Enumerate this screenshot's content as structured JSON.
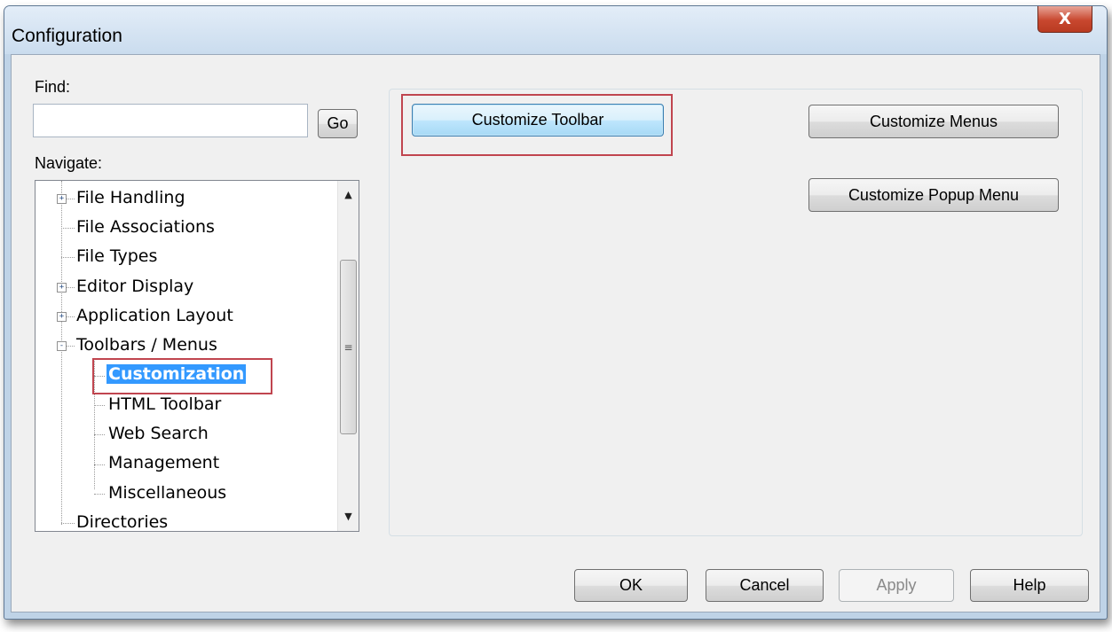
{
  "window": {
    "title": "Configuration",
    "close_glyph": "X"
  },
  "find": {
    "label": "Find:",
    "value": "",
    "go_label": "Go"
  },
  "navigate": {
    "label": "Navigate:",
    "tree": [
      {
        "label": "File Handling",
        "expander": "+",
        "level": 0
      },
      {
        "label": "File Associations",
        "expander": "",
        "level": 0
      },
      {
        "label": "File Types",
        "expander": "",
        "level": 0
      },
      {
        "label": "Editor Display",
        "expander": "+",
        "level": 0
      },
      {
        "label": "Application Layout",
        "expander": "+",
        "level": 0
      },
      {
        "label": "Toolbars / Menus",
        "expander": "-",
        "level": 0
      },
      {
        "label": "Customization",
        "expander": "",
        "level": 1,
        "selected": true
      },
      {
        "label": "HTML Toolbar",
        "expander": "",
        "level": 1
      },
      {
        "label": "Web Search",
        "expander": "",
        "level": 1
      },
      {
        "label": "Management",
        "expander": "",
        "level": 1
      },
      {
        "label": "Miscellaneous",
        "expander": "",
        "level": 1
      },
      {
        "label": "Directories",
        "expander": "",
        "level": 0
      }
    ]
  },
  "panel": {
    "customize_toolbar": "Customize Toolbar",
    "customize_menus": "Customize Menus",
    "customize_popup_menu": "Customize Popup Menu"
  },
  "footer": {
    "ok": "OK",
    "cancel": "Cancel",
    "apply": "Apply",
    "help": "Help"
  },
  "colors": {
    "selection": "#3399ff",
    "highlight_box": "#c0454f",
    "close_button": "#c8472f"
  }
}
